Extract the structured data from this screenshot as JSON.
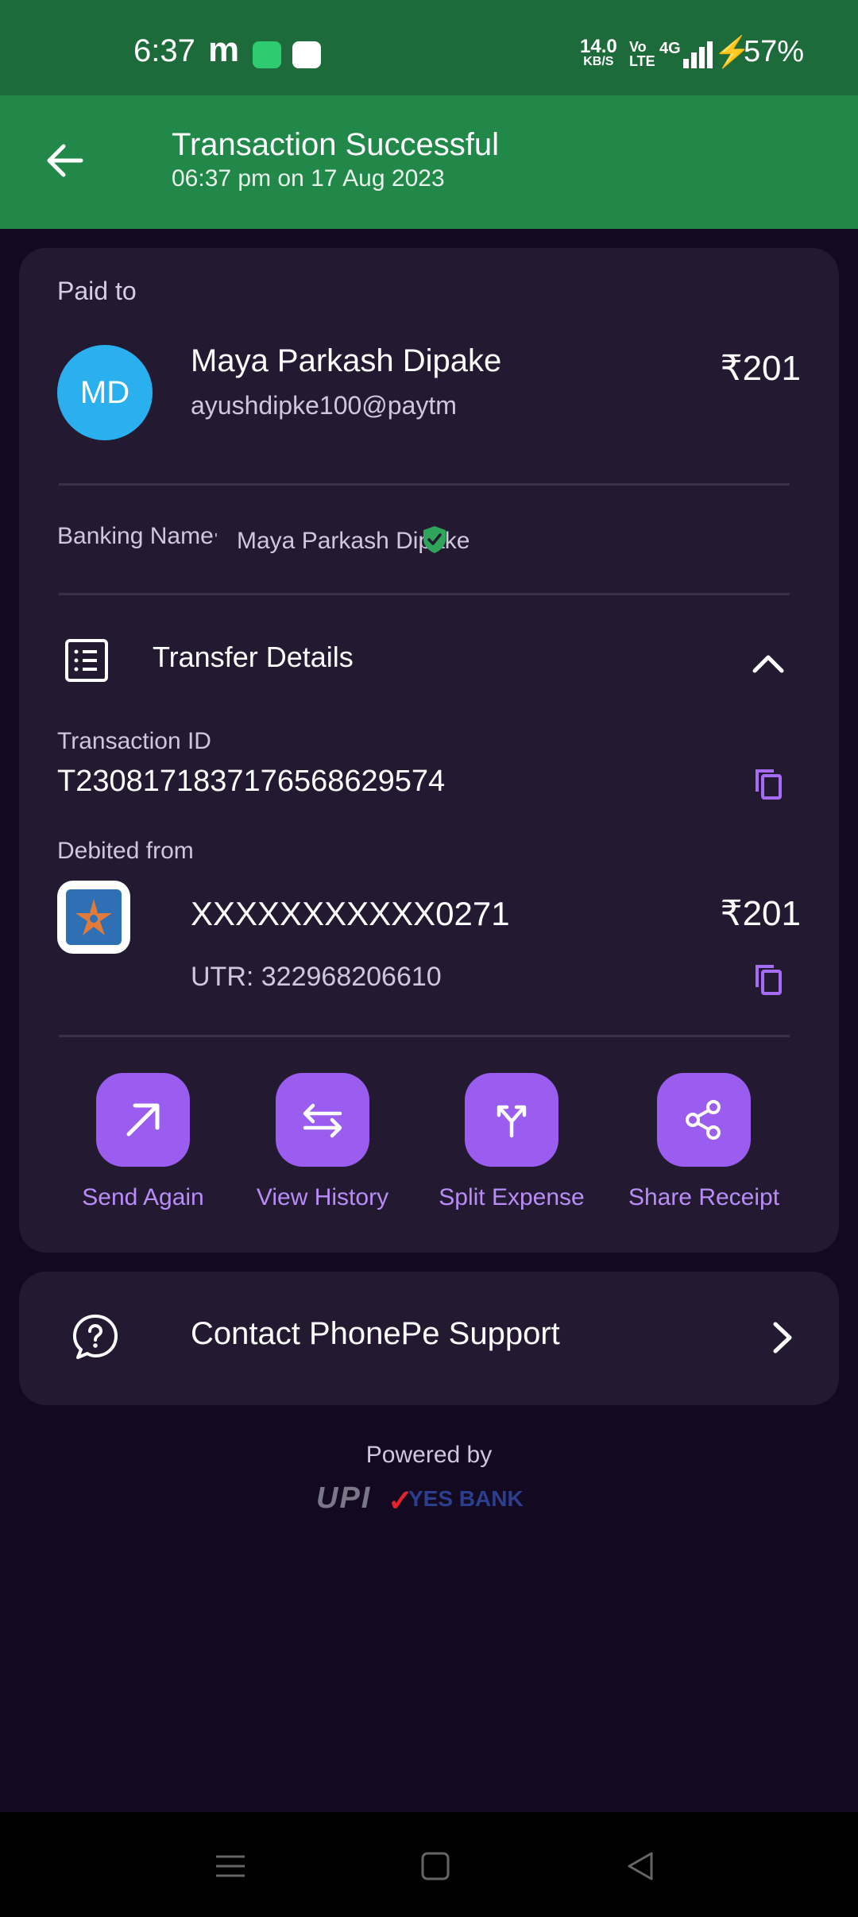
{
  "status_bar": {
    "time": "6:37",
    "app_letter": "m",
    "speed_value": "14.0",
    "speed_unit": "KB/S",
    "volte": "Vo LTE",
    "network": "4G",
    "battery": "57%"
  },
  "header": {
    "title": "Transaction Successful",
    "subtitle": "06:37 pm on 17 Aug 2023"
  },
  "payment": {
    "paid_to_label": "Paid to",
    "avatar_initials": "MD",
    "payee_name": "Maya Parkash Dipake",
    "payee_upi": "ayushdipke100@paytm",
    "amount": "₹201",
    "banking_name_label": "Banking Name",
    "banking_name_sep": "'",
    "banking_name_value": "Maya Parkash Dipake"
  },
  "transfer_details": {
    "title": "Transfer Details",
    "transaction_id_label": "Transaction ID",
    "transaction_id": "T2308171837176568629574",
    "debited_from_label": "Debited from",
    "account": "XXXXXXXXXXX0271",
    "amount": "₹201",
    "utr": "UTR: 322968206610"
  },
  "actions": [
    {
      "label": "Send Again",
      "icon": "arrow-up-right-icon"
    },
    {
      "label": "View History",
      "icon": "arrows-swap-icon"
    },
    {
      "label": "Split Expense",
      "icon": "split-icon"
    },
    {
      "label": "Share Receipt",
      "icon": "share-icon"
    }
  ],
  "support": {
    "label": "Contact PhonePe Support"
  },
  "footer": {
    "powered_by": "Powered by",
    "upi_logo_text": "UPI",
    "bank_logo_text": "YES BANK"
  },
  "colors": {
    "status_bar": "#1d6b3b",
    "app_bar": "#21884a",
    "background": "#130a22",
    "card": "#231a31",
    "accent": "#9b5cf0",
    "avatar": "#2ab0ef"
  }
}
